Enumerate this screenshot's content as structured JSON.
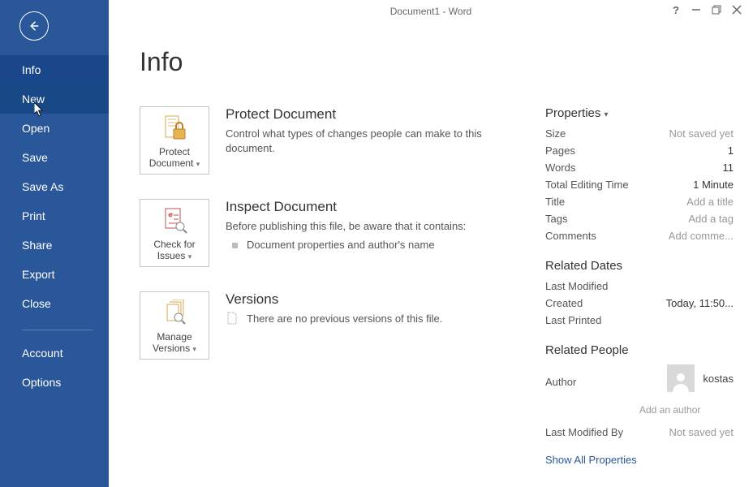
{
  "titlebar": {
    "title": "Document1 - Word"
  },
  "nav": {
    "items": [
      {
        "label": "Info"
      },
      {
        "label": "New"
      },
      {
        "label": "Open"
      },
      {
        "label": "Save"
      },
      {
        "label": "Save As"
      },
      {
        "label": "Print"
      },
      {
        "label": "Share"
      },
      {
        "label": "Export"
      },
      {
        "label": "Close"
      }
    ],
    "footer": [
      {
        "label": "Account"
      },
      {
        "label": "Options"
      }
    ]
  },
  "page": {
    "heading": "Info"
  },
  "protect": {
    "tile_label": "Protect Document",
    "heading": "Protect Document",
    "body": "Control what types of changes people can make to this document."
  },
  "inspect": {
    "tile_label": "Check for Issues",
    "heading": "Inspect Document",
    "body": "Before publishing this file, be aware that it contains:",
    "item1": "Document properties and author's name"
  },
  "versions": {
    "tile_label": "Manage Versions",
    "heading": "Versions",
    "body": "There are no previous versions of this file."
  },
  "properties": {
    "header": "Properties",
    "size_label": "Size",
    "size_val": "Not saved yet",
    "pages_label": "Pages",
    "pages_val": "1",
    "words_label": "Words",
    "words_val": "11",
    "edit_label": "Total Editing Time",
    "edit_val": "1 Minute",
    "title_label": "Title",
    "title_val": "Add a title",
    "tags_label": "Tags",
    "tags_val": "Add a tag",
    "comments_label": "Comments",
    "comments_val": "Add comme...",
    "dates_header": "Related Dates",
    "modified_label": "Last Modified",
    "modified_val": "",
    "created_label": "Created",
    "created_val": "Today, 11:50...",
    "printed_label": "Last Printed",
    "printed_val": "",
    "people_header": "Related People",
    "author_label": "Author",
    "author_val": "kostas",
    "add_author": "Add an author",
    "lastmod_label": "Last Modified By",
    "lastmod_val": "Not saved yet",
    "showall": "Show All Properties"
  }
}
